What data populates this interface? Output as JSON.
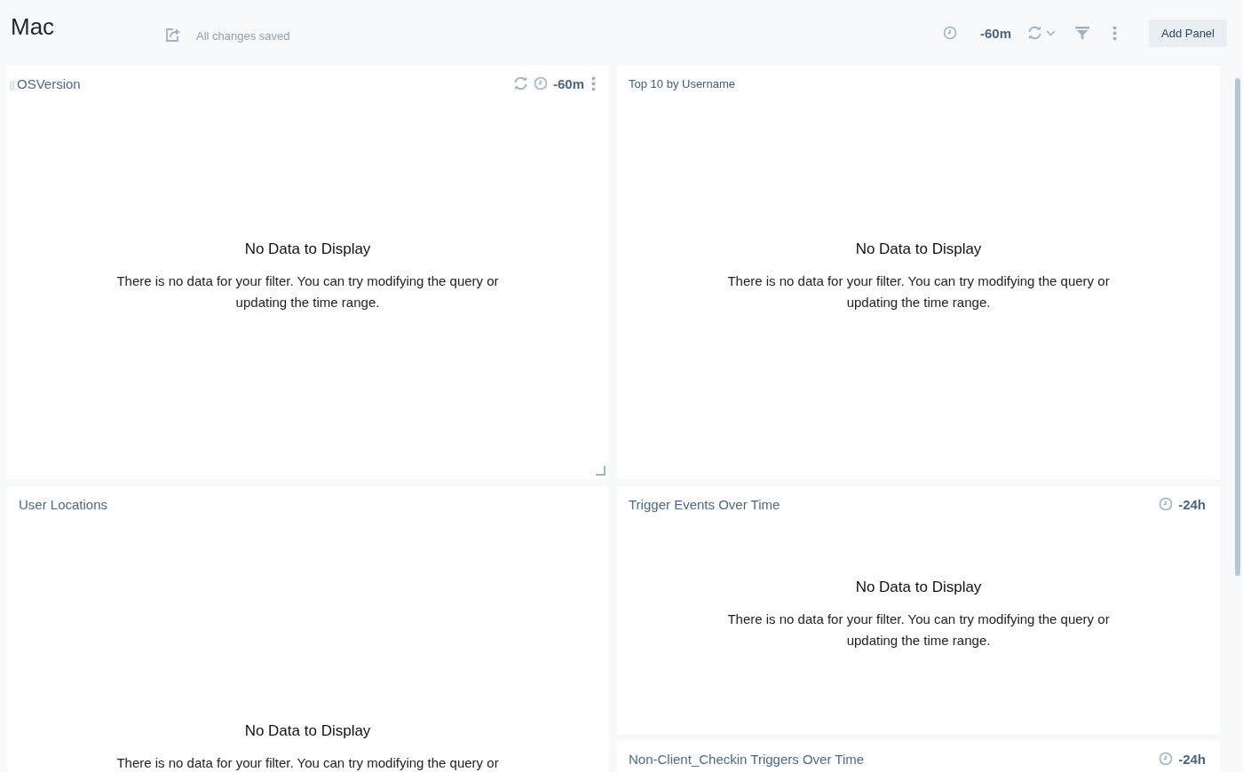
{
  "dashboard": {
    "title": "Mac",
    "save_status": "All changes saved",
    "time_range": "-60m",
    "add_button": "Add Panel"
  },
  "columns": [
    {
      "panels": [
        {
          "title": "OSVersion",
          "drag_handle": true,
          "refresh": true,
          "time": "-60m",
          "menu": true,
          "resize_handle": true,
          "message_title": "No Data to Display",
          "message": "There is no data for your filter. You can try modifying the query or updating the time range."
        },
        {
          "title": "User Locations",
          "drag_handle": false,
          "refresh": false,
          "menu": false,
          "message_title": "No Data to Display",
          "message": "There is no data for your filter. You can try modifying the query or"
        }
      ]
    },
    {
      "panels": [
        {
          "title": "Top 10 by Username",
          "small_title": true,
          "drag_handle": false,
          "refresh": false,
          "menu": false,
          "resize_handle": false,
          "message_title": "No Data to Display",
          "message": "There is no data for your filter. You can try modifying the query or updating the time range."
        },
        {
          "title": "Trigger Events Over Time",
          "drag_handle": false,
          "refresh": false,
          "time": "-24h",
          "menu": false,
          "resize_handle": false,
          "message_title": "No Data to Display",
          "message": "There is no data for your filter. You can try modifying the query or updating the time range."
        },
        {
          "title": "Non-Client_Checkin Triggers Over Time",
          "drag_handle": false,
          "refresh": false,
          "time": "-24h",
          "menu": false
        }
      ]
    }
  ]
}
